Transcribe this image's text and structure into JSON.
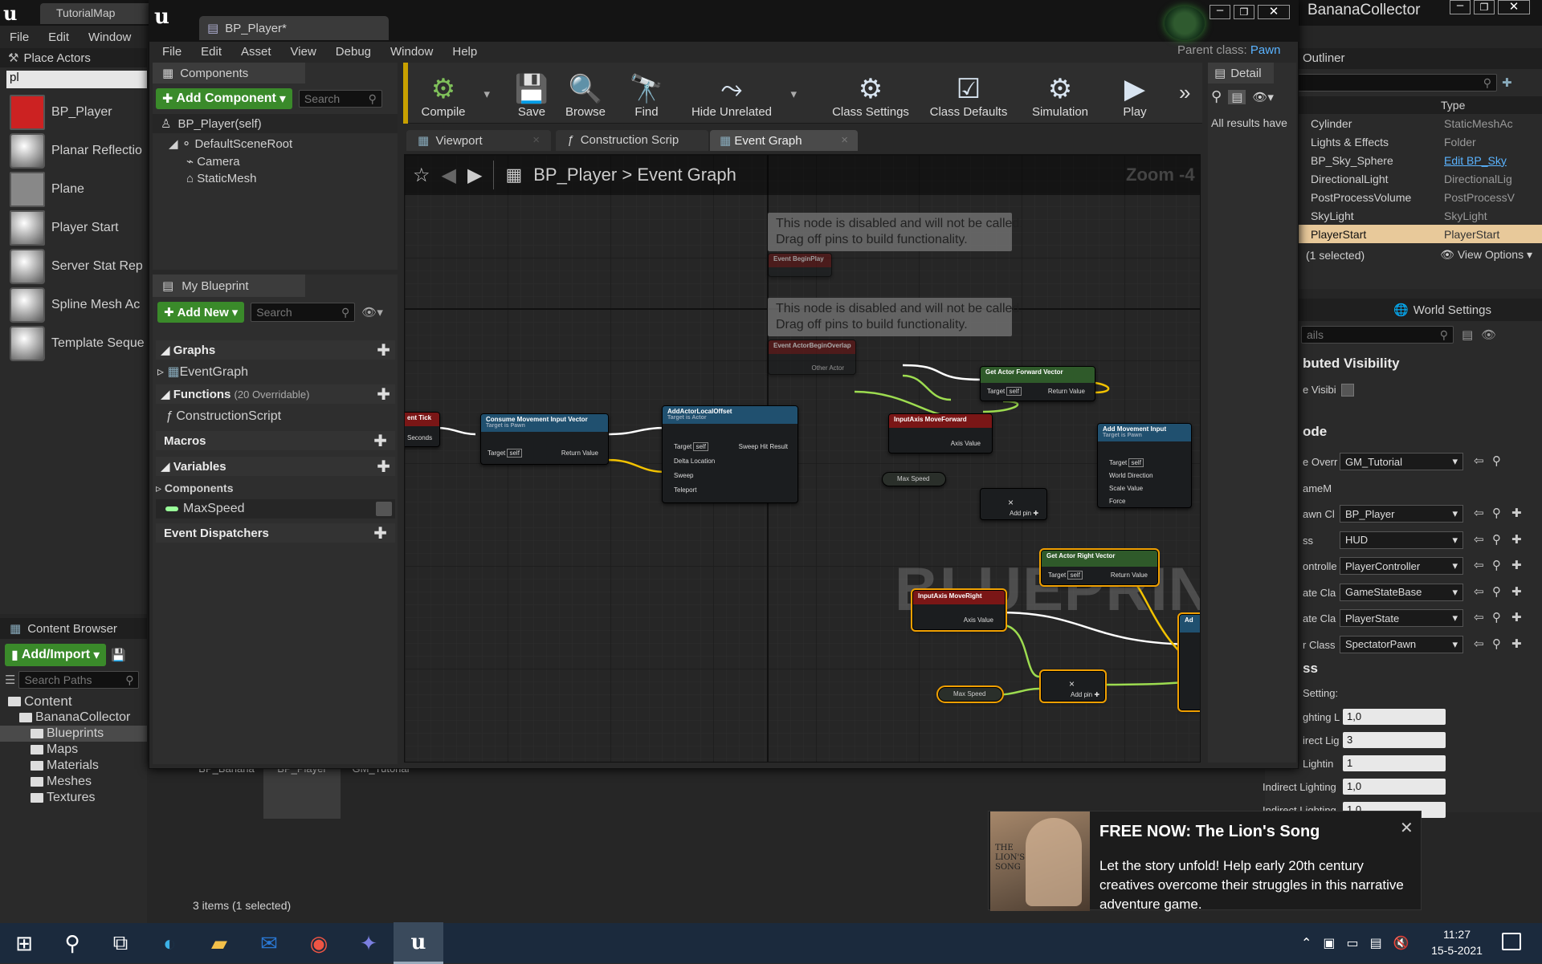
{
  "main_editor": {
    "title": "TutorialMap",
    "menu": [
      "File",
      "Edit",
      "Window"
    ],
    "place_actors": {
      "tab_label": "Place Actors",
      "search_value": "pl",
      "items": [
        {
          "label": "BP_Player",
          "icon": "bp-player-icon"
        },
        {
          "label": "Planar Reflectio",
          "icon": "sphere-icon"
        },
        {
          "label": "Plane",
          "icon": "plane-icon"
        },
        {
          "label": "Player Start",
          "icon": "player-start-icon"
        },
        {
          "label": "Server Stat Rep",
          "icon": "sphere-icon"
        },
        {
          "label": "Spline Mesh Ac",
          "icon": "sphere-icon"
        },
        {
          "label": "Template Seque",
          "icon": "sphere-icon"
        }
      ]
    },
    "content_browser": {
      "tab_label": "Content Browser",
      "add_import": "Add/Import",
      "search_placeholder": "Search Paths",
      "tree": [
        {
          "label": "Content",
          "level": 0
        },
        {
          "label": "BananaCollector",
          "level": 1
        },
        {
          "label": "Blueprints",
          "level": 2,
          "selected": true
        },
        {
          "label": "Maps",
          "level": 2
        },
        {
          "label": "Materials",
          "level": 2
        },
        {
          "label": "Meshes",
          "level": 2
        },
        {
          "label": "Textures",
          "level": 2
        }
      ],
      "assets": [
        "BP_Banana",
        "BP_Player",
        "GM_Tutorial"
      ],
      "status": "3 items (1 selected)"
    },
    "project_title": "BananaCollector",
    "outliner": {
      "tab_label": "Outliner",
      "type_header": "Type",
      "rows": [
        {
          "name": "Cylinder",
          "type": "StaticMeshAc"
        },
        {
          "name": "Lights & Effects",
          "type": "Folder"
        },
        {
          "name": "BP_Sky_Sphere",
          "type": "Edit BP_Sky"
        },
        {
          "name": "DirectionalLight",
          "type": "DirectionalLig"
        },
        {
          "name": "PostProcessVolume",
          "type": "PostProcessV"
        },
        {
          "name": "SkyLight",
          "type": "SkyLight"
        },
        {
          "name": "PlayerStart",
          "type": "PlayerStart"
        }
      ],
      "status": "(1 selected)",
      "view_options": "View Options"
    },
    "world_settings": {
      "tab_label": "World Settings",
      "search_placeholder": "ails",
      "section1": "buted Visibility",
      "visib_label": "e Visibi",
      "section2": "ode",
      "rows": [
        {
          "label": "e Overr",
          "value": "GM_Tutorial"
        },
        {
          "label": "ameM",
          "value": ""
        },
        {
          "label": "awn Cl",
          "value": "BP_Player"
        },
        {
          "label": "ss",
          "value": "HUD"
        },
        {
          "label": "ontrolle",
          "value": "PlayerController"
        },
        {
          "label": "ate Cla",
          "value": "GameStateBase"
        },
        {
          "label": "ate Cla",
          "value": "PlayerState"
        },
        {
          "label": "r Class",
          "value": "SpectatorPawn"
        }
      ],
      "section3": "ss",
      "settings_label": "Setting:",
      "num_rows": [
        {
          "label": "ghting L",
          "value": "1,0"
        },
        {
          "label": "irect Lig",
          "value": "3"
        },
        {
          "label": "Lightin",
          "value": "1"
        },
        {
          "label": "Indirect Lighting",
          "value": "1,0"
        },
        {
          "label": "Indirect Lighting",
          "value": "1,0"
        }
      ]
    }
  },
  "bp_window": {
    "title": "BP_Player*",
    "menu": [
      "File",
      "Edit",
      "Asset",
      "View",
      "Debug",
      "Window",
      "Help"
    ],
    "parent_class_label": "Parent class:",
    "parent_class_value": "Pawn",
    "components": {
      "tab_label": "Components",
      "add_component": "Add Component",
      "search_placeholder": "Search",
      "self_label": "BP_Player(self)",
      "tree": [
        "DefaultSceneRoot",
        "Camera",
        "StaticMesh"
      ]
    },
    "my_blueprint": {
      "tab_label": "My Blueprint",
      "add_new": "Add New",
      "search_placeholder": "Search",
      "graphs_label": "Graphs",
      "event_graph": "EventGraph",
      "functions_label": "Functions",
      "functions_note": "(20 Overridable)",
      "construction_script": "ConstructionScript",
      "macros_label": "Macros",
      "variables_label": "Variables",
      "components_label": "Components",
      "max_speed": "MaxSpeed",
      "event_dispatchers": "Event Dispatchers"
    },
    "toolbar": [
      {
        "label": "Compile",
        "icon": "compile-icon"
      },
      {
        "label": "Save",
        "icon": "save-icon"
      },
      {
        "label": "Browse",
        "icon": "browse-icon"
      },
      {
        "label": "Find",
        "icon": "find-icon"
      },
      {
        "label": "Hide Unrelated",
        "icon": "hide-unrelated-icon"
      },
      {
        "label": "Class Settings",
        "icon": "class-settings-icon"
      },
      {
        "label": "Class Defaults",
        "icon": "class-defaults-icon"
      },
      {
        "label": "Simulation",
        "icon": "simulation-icon"
      },
      {
        "label": "Play",
        "icon": "play-icon"
      }
    ],
    "tabs": [
      "Viewport",
      "Construction Scrip",
      "Event Graph"
    ],
    "breadcrumb": {
      "root": "BP_Player",
      "sep": ">",
      "current": "Event Graph"
    },
    "zoom": "Zoom -4",
    "watermark": "BLUEPRINT",
    "details_tab": "Detail",
    "details_text": "All results have",
    "comments": [
      "This node is disabled and will not be called.\nDrag off pins to build functionality.",
      "This node is disabled and will not be called.\nDrag off pins to build functionality."
    ],
    "nodes": {
      "begin_play": "Event BeginPlay",
      "begin_overlap": "Event ActorBeginOverlap",
      "other_actor": "Other Actor",
      "tick": "ent Tick",
      "seconds": "Seconds",
      "consume": "Consume Movement Input Vector",
      "consume_sub": "Target is Pawn",
      "target": "Target",
      "self": "self",
      "return_value": "Return Value",
      "add_offset": "AddActorLocalOffset",
      "add_offset_sub": "Target is Actor",
      "sweep_hit": "Sweep Hit Result",
      "delta_location": "Delta Location",
      "sweep": "Sweep",
      "teleport": "Teleport",
      "get_forward": "Get Actor Forward Vector",
      "get_forward_sub": "Target is Actor",
      "input_forward": "InputAxis MoveForward",
      "axis_value": "Axis Value",
      "add_movement": "Add Movement Input",
      "add_movement_sub": "Target is Pawn",
      "world_direction": "World Direction",
      "scale_value": "Scale Value",
      "force": "Force",
      "max_speed": "Max Speed",
      "add_pin": "Add pin",
      "get_right": "Get Actor Right Vector",
      "get_right_sub": "Target is Actor",
      "input_right": "InputAxis MoveRight",
      "ad_partial": "Ad"
    }
  },
  "notification": {
    "title": "FREE NOW: The Lion's Song",
    "body": "Let the story unfold! Help early 20th century creatives overcome their struggles in this narrative adventure game.",
    "art_text": "THE LION'S SONG"
  },
  "taskbar": {
    "time": "11:27",
    "date": "15-5-2021",
    "apps": [
      "windows-start-icon",
      "search-icon",
      "task-view-icon",
      "edge-icon",
      "file-explorer-icon",
      "outlook-icon",
      "chrome-icon",
      "teams-icon",
      "unreal-icon"
    ]
  }
}
